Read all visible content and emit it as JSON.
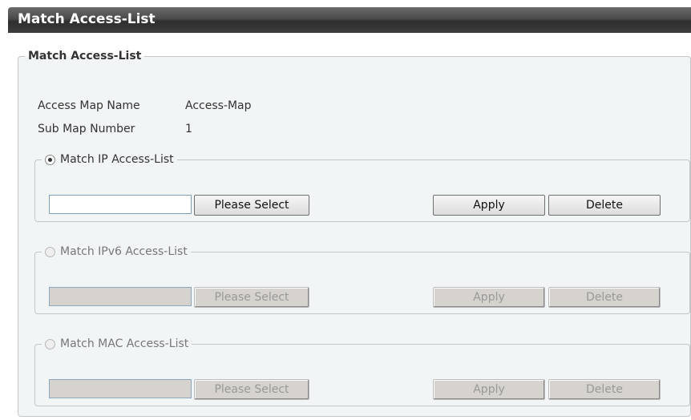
{
  "header": {
    "title": "Match Access-List"
  },
  "form": {
    "legend": "Match Access-List",
    "access_map_name_label": "Access Map Name",
    "access_map_name_value": "Access-Map",
    "sub_map_number_label": "Sub Map Number",
    "sub_map_number_value": "1"
  },
  "sections": [
    {
      "label": "Match IP Access-List",
      "selected": true,
      "input_value": "",
      "select_label": "Please Select",
      "apply_label": "Apply",
      "delete_label": "Delete"
    },
    {
      "label": "Match IPv6 Access-List",
      "selected": false,
      "input_value": "",
      "select_label": "Please Select",
      "apply_label": "Apply",
      "delete_label": "Delete"
    },
    {
      "label": "Match MAC Access-List",
      "selected": false,
      "input_value": "",
      "select_label": "Please Select",
      "apply_label": "Apply",
      "delete_label": "Delete"
    }
  ]
}
